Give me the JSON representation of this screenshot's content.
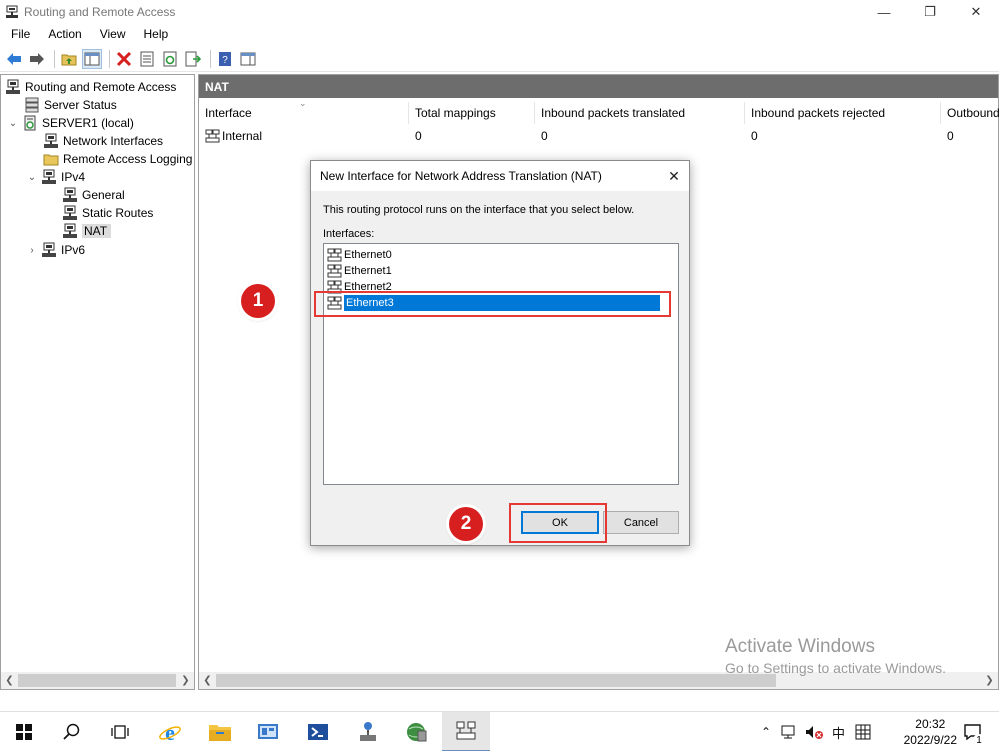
{
  "window": {
    "title": "Routing and Remote Access",
    "controls": [
      "—",
      "❐",
      "✕"
    ]
  },
  "menu": [
    "File",
    "Action",
    "View",
    "Help"
  ],
  "tree": {
    "items": [
      {
        "label": "Routing and Remote Access"
      },
      {
        "label": "Server Status"
      },
      {
        "label": "SERVER1 (local)",
        "expander": "⌄"
      },
      {
        "label": "Network Interfaces"
      },
      {
        "label": "Remote Access Logging"
      },
      {
        "label": "IPv4",
        "expander": "⌄"
      },
      {
        "label": "General"
      },
      {
        "label": "Static Routes"
      },
      {
        "label": "NAT"
      },
      {
        "label": "IPv6",
        "expander": "›"
      }
    ]
  },
  "right_pane": {
    "header": "NAT",
    "columns": [
      "Interface",
      "Total mappings",
      "Inbound packets translated",
      "Inbound packets rejected",
      "Outbound"
    ],
    "rows": [
      {
        "cells": [
          "Internal",
          "0",
          "0",
          "0",
          "0"
        ]
      }
    ]
  },
  "watermark": {
    "line1": "Activate Windows",
    "line2": "Go to Settings to activate Windows."
  },
  "dialog": {
    "title": "New Interface for Network Address Translation (NAT)",
    "close": "✕",
    "description": "This routing protocol runs on the interface that you select below.",
    "interfaces_label": "Interfaces:",
    "interfaces": [
      "Ethernet0",
      "Ethernet1",
      "Ethernet2",
      "Ethernet3"
    ],
    "selected_interface": "Ethernet3",
    "ok_label": "OK",
    "cancel_label": "Cancel"
  },
  "annotations": {
    "step1": "1",
    "step2": "2"
  },
  "taskbar": {
    "time": "20:32",
    "date": "2022/9/22",
    "ime": "中",
    "notification_count": "1"
  },
  "colors": {
    "accent": "#0078d7",
    "annotation": "#e53935",
    "pane_header": "#6d6d6d"
  }
}
